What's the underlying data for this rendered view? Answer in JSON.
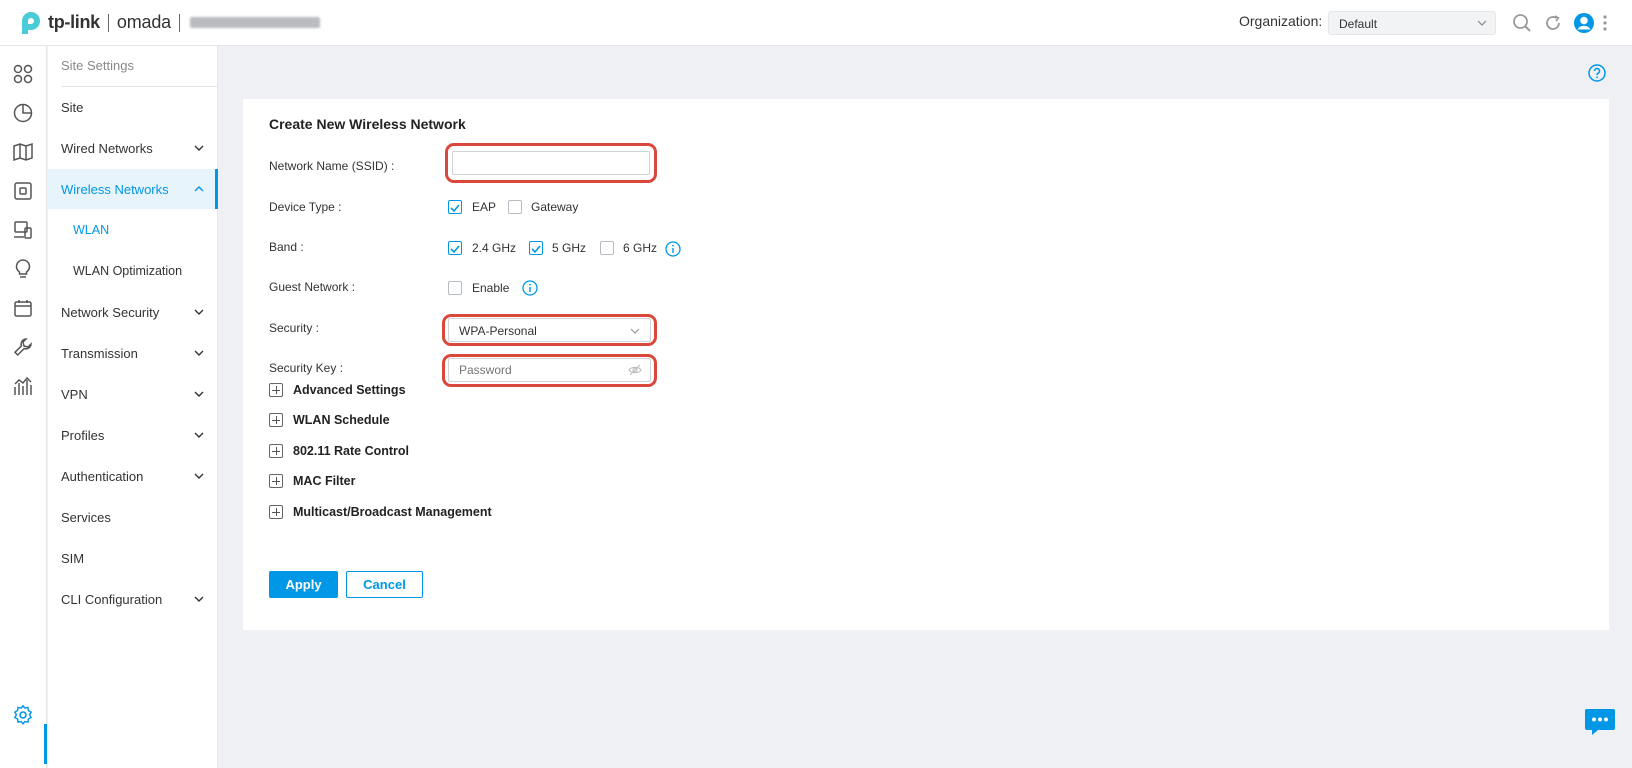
{
  "header": {
    "brand": "tp-link",
    "product": "omada",
    "org_label": "Organization:",
    "org_value": "Default",
    "icons": [
      "search-icon",
      "refresh-icon",
      "user-avatar-icon",
      "more-vertical-icon"
    ]
  },
  "rail": {
    "icons": [
      "dashboard-icon",
      "statistics-icon",
      "map-icon",
      "devices-icon",
      "clients-icon",
      "insight-icon",
      "log-icon",
      "tools-icon",
      "reports-icon",
      "settings-icon"
    ]
  },
  "sidebar": {
    "title": "Site Settings",
    "items": [
      {
        "label": "Site",
        "has_chevron": false
      },
      {
        "label": "Wired Networks",
        "has_chevron": true
      },
      {
        "label": "Wireless Networks",
        "has_chevron": true,
        "expanded": true,
        "active": true
      },
      {
        "label": "WLAN",
        "sub": true,
        "selected": true
      },
      {
        "label": "WLAN Optimization",
        "sub": true
      },
      {
        "label": "Network Security",
        "has_chevron": true
      },
      {
        "label": "Transmission",
        "has_chevron": true
      },
      {
        "label": "VPN",
        "has_chevron": true
      },
      {
        "label": "Profiles",
        "has_chevron": true
      },
      {
        "label": "Authentication",
        "has_chevron": true
      },
      {
        "label": "Services",
        "has_chevron": false
      },
      {
        "label": "SIM",
        "has_chevron": false
      },
      {
        "label": "CLI Configuration",
        "has_chevron": true
      }
    ]
  },
  "form": {
    "title": "Create New Wireless Network",
    "ssid_label": "Network Name (SSID) :",
    "ssid_value": "",
    "device_type_label": "Device Type :",
    "device_eap": "EAP",
    "device_eap_checked": true,
    "device_gateway": "Gateway",
    "device_gateway_checked": false,
    "band_label": "Band :",
    "band_24": "2.4 GHz",
    "band_24_checked": true,
    "band_5": "5 GHz",
    "band_5_checked": true,
    "band_6": "6 GHz",
    "band_6_checked": false,
    "guest_label": "Guest Network :",
    "guest_enable": "Enable",
    "guest_checked": false,
    "security_label": "Security :",
    "security_value": "WPA-Personal",
    "key_label": "Security Key :",
    "key_placeholder": "Password",
    "sections": [
      "Advanced Settings",
      "WLAN Schedule",
      "802.11 Rate Control",
      "MAC Filter",
      "Multicast/Broadcast Management"
    ],
    "apply": "Apply",
    "cancel": "Cancel"
  },
  "colors": {
    "accent": "#0097e6",
    "highlight": "#d9483b"
  }
}
